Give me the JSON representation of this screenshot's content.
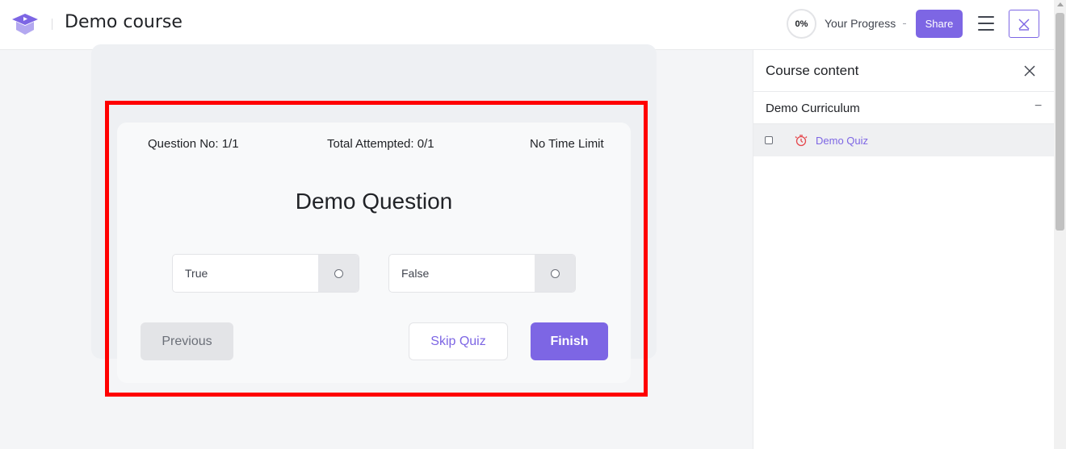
{
  "header": {
    "course_title": "Demo course",
    "progress_percent": "0%",
    "progress_label": "Your Progress",
    "share_label": "Share",
    "logo_icon": "graduation-cap-icon",
    "menu_icon": "hamburger-menu-icon",
    "close_icon": "close-icon"
  },
  "quiz": {
    "question_no": "Question No: 1/1",
    "total_attempted": "Total Attempted: 0/1",
    "time_limit": "No Time Limit",
    "question_title": "Demo Question",
    "options": [
      {
        "label": "True",
        "selected": false
      },
      {
        "label": "False",
        "selected": false
      }
    ],
    "previous_label": "Previous",
    "skip_label": "Skip Quiz",
    "finish_label": "Finish"
  },
  "sidebar": {
    "title": "Course content",
    "topic": {
      "title": "Demo Curriculum",
      "toggle": "−"
    },
    "lessons": [
      {
        "label": "Demo Quiz",
        "icon": "quiz-timer-icon",
        "completed": false
      }
    ]
  },
  "colors": {
    "accent": "#7d66e4",
    "highlight_border": "#ff0000",
    "quiz_icon": "#e5484d"
  }
}
